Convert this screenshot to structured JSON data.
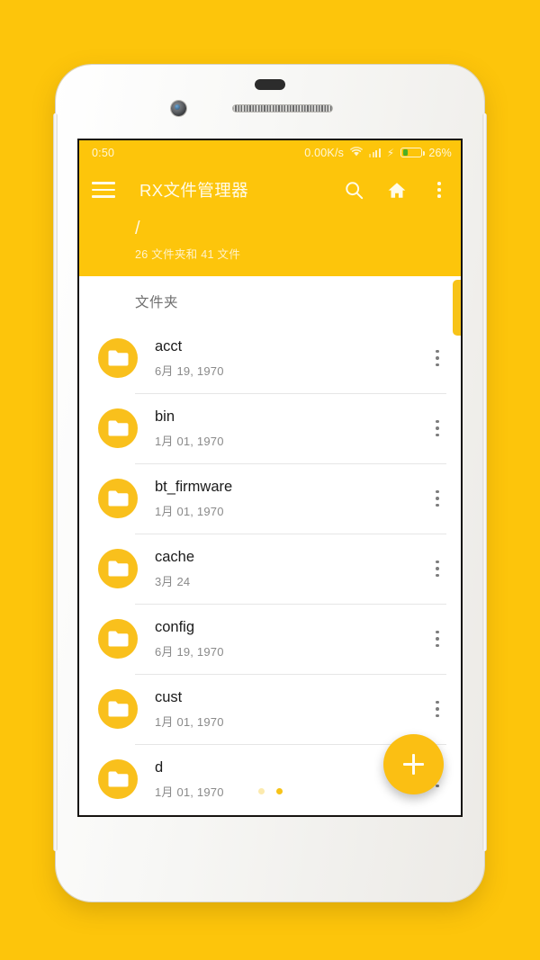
{
  "status_bar": {
    "time": "0:50",
    "network_speed": "0.00K/s",
    "wifi_icon": "wifi-icon",
    "signal_icon": "signal-bars-icon",
    "charging_icon": "charging-bolt-icon",
    "battery_icon": "battery-icon",
    "battery_percent": "26%",
    "battery_level": 26
  },
  "appbar": {
    "menu_icon": "hamburger-menu-icon",
    "title": "RX文件管理器",
    "search_icon": "search-icon",
    "home_icon": "home-icon",
    "overflow_icon": "overflow-menu-icon"
  },
  "path": {
    "current": "/",
    "summary": "26 文件夹和 41 文件"
  },
  "section": {
    "title": "文件夹"
  },
  "rows": [
    {
      "name": "acct",
      "date": "6月 19, 1970"
    },
    {
      "name": "bin",
      "date": "1月 01, 1970"
    },
    {
      "name": "bt_firmware",
      "date": "1月 01, 1970"
    },
    {
      "name": "cache",
      "date": "3月 24"
    },
    {
      "name": "config",
      "date": "6月 19, 1970"
    },
    {
      "name": "cust",
      "date": "1月 01, 1970"
    },
    {
      "name": "d",
      "date": "1月 01, 1970"
    }
  ],
  "fab": {
    "icon": "plus-icon",
    "label": "+"
  },
  "page_dots": {
    "count": 2,
    "active_index": 1
  },
  "colors": {
    "primary": "#FDC50B",
    "accent": "#F9C01C",
    "background": "#FDC50B",
    "surface": "#FFFFFF",
    "battery_fill": "#4CAF24",
    "title_text": "#FFFBE9",
    "row_name_text": "#1B1B1B",
    "row_date_text": "#8A8A8A"
  }
}
